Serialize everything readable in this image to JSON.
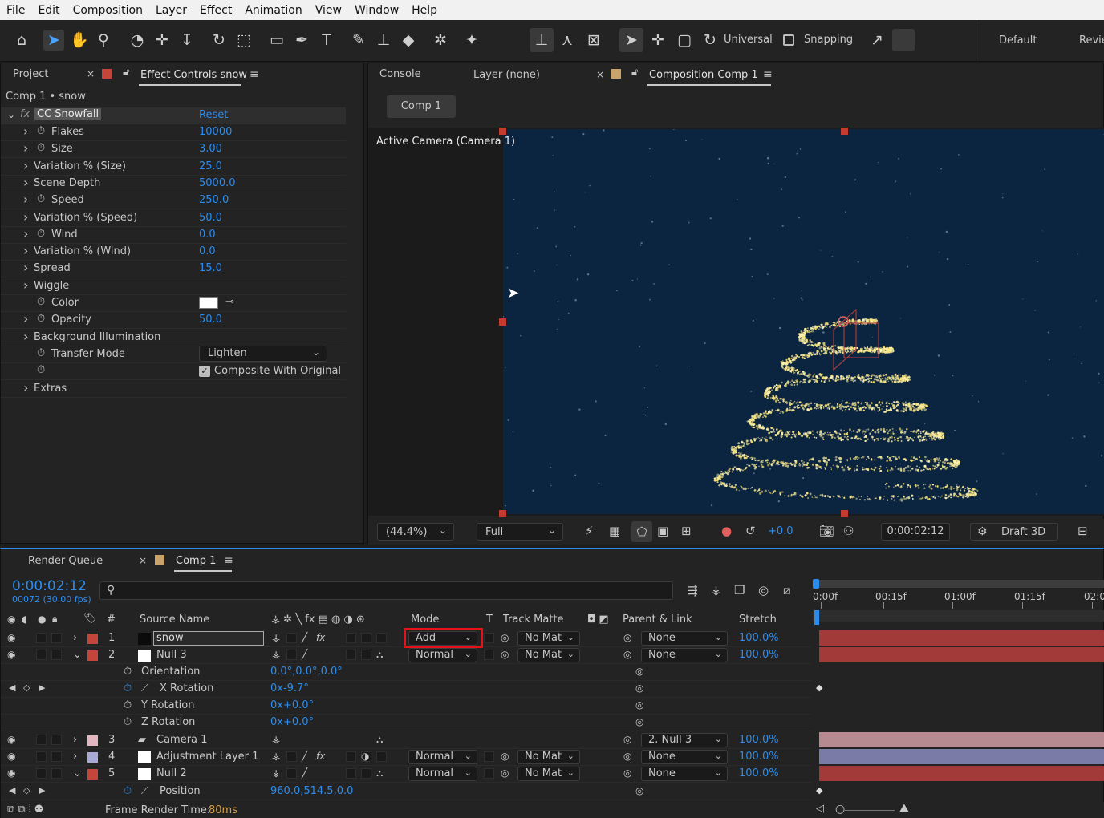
{
  "menu": [
    "File",
    "Edit",
    "Composition",
    "Layer",
    "Effect",
    "Animation",
    "View",
    "Window",
    "Help"
  ],
  "toolbar": {
    "universal_label": "Universal",
    "snapping_label": "Snapping",
    "workspace_default": "Default",
    "workspace_review": "Revie"
  },
  "left_panel": {
    "tab_project": "Project",
    "tab_effect": "Effect Controls snow",
    "breadcrumb": "Comp 1 • snow",
    "effect_name": "CC Snowfall",
    "reset_label": "Reset",
    "params": [
      {
        "name": "Flakes",
        "value": "10000",
        "stopwatch": true,
        "expand": true
      },
      {
        "name": "Size",
        "value": "3.00",
        "stopwatch": true,
        "expand": true
      },
      {
        "name": "Variation % (Size)",
        "value": "25.0",
        "stopwatch": false,
        "expand": true
      },
      {
        "name": "Scene Depth",
        "value": "5000.0",
        "stopwatch": false,
        "expand": true
      },
      {
        "name": "Speed",
        "value": "250.0",
        "stopwatch": true,
        "expand": true
      },
      {
        "name": "Variation % (Speed)",
        "value": "50.0",
        "stopwatch": false,
        "expand": true
      },
      {
        "name": "Wind",
        "value": "0.0",
        "stopwatch": true,
        "expand": true
      },
      {
        "name": "Variation % (Wind)",
        "value": "0.0",
        "stopwatch": false,
        "expand": true
      },
      {
        "name": "Spread",
        "value": "15.0",
        "stopwatch": false,
        "expand": true
      },
      {
        "name": "Wiggle",
        "value": "",
        "stopwatch": false,
        "expand": true
      },
      {
        "name": "Color",
        "value": "",
        "stopwatch": true,
        "expand": false
      },
      {
        "name": "Opacity",
        "value": "50.0",
        "stopwatch": true,
        "expand": true
      },
      {
        "name": "Background Illumination",
        "value": "",
        "stopwatch": false,
        "expand": true
      },
      {
        "name": "Transfer Mode",
        "value": "",
        "stopwatch": true,
        "expand": false
      },
      {
        "name": "",
        "value": "",
        "stopwatch": true,
        "expand": false
      },
      {
        "name": "Extras",
        "value": "",
        "stopwatch": false,
        "expand": true
      }
    ],
    "transfer_mode_value": "Lighten",
    "composite_label": "Composite With Original"
  },
  "comp_panel": {
    "tab_console": "Console",
    "tab_layer": "Layer (none)",
    "tab_comp": "Composition Comp 1",
    "comp_chip": "Comp 1",
    "camera_label": "Active Camera (Camera 1)",
    "zoom": "(44.4%)",
    "resolution": "Full",
    "exposure": "+0.0",
    "timecode": "0:00:02:12",
    "renderer": "Draft 3D",
    "bg_color": "#0b2440"
  },
  "timeline": {
    "tab_render": "Render Queue",
    "tab_comp": "Comp 1",
    "timecode": "0:00:02:12",
    "frame_info": "00072 (30.00 fps)",
    "search_placeholder": "",
    "headers": {
      "num": "#",
      "source": "Source Name",
      "mode": "Mode",
      "t": "T",
      "track": "Track Matte",
      "parent": "Parent & Link",
      "stretch": "Stretch"
    },
    "ruler": [
      "0:00f",
      "00:15f",
      "01:00f",
      "01:15f",
      "02:0"
    ],
    "layers": [
      {
        "num": "1",
        "name": "snow",
        "label_color": "#c4453a",
        "mode": "Add",
        "track": "No Mat",
        "parent": "None",
        "stretch": "100.0%",
        "expanded": false,
        "bar_color": "#a33a3a"
      },
      {
        "num": "2",
        "name": "Null 3",
        "label_color": "#c4453a",
        "mode": "Normal",
        "track": "No Mat",
        "parent": "None",
        "stretch": "100.0%",
        "expanded": true,
        "bar_color": "#a33a3a"
      }
    ],
    "props_null3": [
      {
        "name": "Orientation",
        "value": "0.0°,0.0°,0.0°"
      },
      {
        "name": "X Rotation",
        "value": "0x-9.7°"
      },
      {
        "name": "Y Rotation",
        "value": "0x+0.0°"
      },
      {
        "name": "Z Rotation",
        "value": "0x+0.0°"
      }
    ],
    "layers2": [
      {
        "num": "3",
        "name": "Camera 1",
        "label_color": "#e4b7c0",
        "mode": "",
        "track": "",
        "parent": "2. Null 3",
        "stretch": "100.0%",
        "bar_color": "#b78a92"
      },
      {
        "num": "4",
        "name": "Adjustment Layer 1",
        "label_color": "#a9a9d8",
        "mode": "Normal",
        "track": "No Mat",
        "parent": "None",
        "stretch": "100.0%",
        "bar_color": "#7b7ba7"
      },
      {
        "num": "5",
        "name": "Null 2",
        "label_color": "#c4453a",
        "mode": "Normal",
        "track": "No Mat",
        "parent": "None",
        "stretch": "100.0%",
        "bar_color": "#a33a3a"
      }
    ],
    "prop_null2": {
      "name": "Position",
      "value": "960.0,514.5,0.0"
    },
    "frame_render_label": "Frame Render Time:",
    "frame_render_value": "80ms"
  }
}
